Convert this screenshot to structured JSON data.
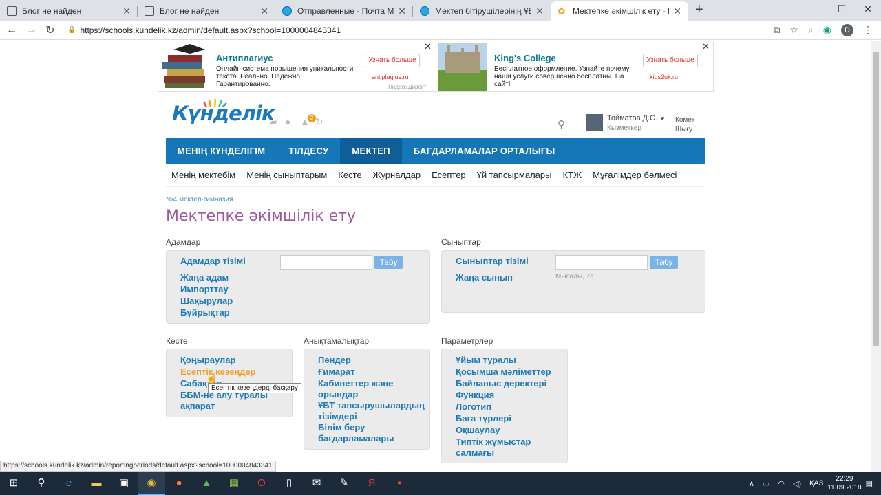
{
  "browser": {
    "tabs": [
      {
        "title": "Блог не найден",
        "active": false
      },
      {
        "title": "Блог не найден",
        "active": false
      },
      {
        "title": "Отправленные - Почта Mail.Ru",
        "active": false
      },
      {
        "title": "Мектеп бітірушілерінің ҰБТ-ға С",
        "active": false
      },
      {
        "title": "Мектепке әкімшілік ету - Kunde",
        "active": true
      }
    ],
    "url": "https://schools.kundelik.kz/admin/default.aspx?school=1000004843341",
    "profile_initial": "D",
    "status_url": "https://schools.kundelik.kz/admin/reportingperiods/default.aspx?school=1000004843341"
  },
  "ads": [
    {
      "title": "Антиплагиус",
      "desc": "Онлайн система повышения уникальности текста. Реально. Надежно. Гарантированно.",
      "button": "Узнать больше",
      "domain": "antiplagius.ru"
    },
    {
      "title": "King's College",
      "desc": "Бесплатное оформление. Узнайте почему наши услуги совершенно бесплатны. На сайт!",
      "button": "Узнать больше",
      "domain": "kids2uk.ru"
    }
  ],
  "ads_source": "Яндекс.Директ",
  "header": {
    "logo": "Күнделік",
    "badge": "2",
    "user_name": "Тойматов Д.С.",
    "user_role": "Қызметкер",
    "help1": "Көмек",
    "help2": "Шығу"
  },
  "mainnav": [
    "МЕНІҢ КҮНДЕЛІГІМ",
    "ТІЛДЕСУ",
    "МЕКТЕП",
    "БАҒДАРЛАМАЛАР ОРТАЛЫҒЫ"
  ],
  "subnav": [
    "Менің мектебім",
    "Менің сыныптарым",
    "Кесте",
    "Журналдар",
    "Есептер",
    "Үй тапсырмалары",
    "КТЖ",
    "Мұғалімдер бөлмесі"
  ],
  "crumb": "№4 мектеп-гимназия",
  "page_title": "Мектепке әкімшілік ету",
  "people": {
    "heading": "Адамдар",
    "links": [
      "Адамдар тізімі",
      "Жаңа адам",
      "Импорттау",
      "Шақырулар",
      "Бұйрықтар"
    ],
    "button": "Табу"
  },
  "classes": {
    "heading": "Сыныптар",
    "links": [
      "Сыныптар тізімі",
      "Жаңа сынып"
    ],
    "button": "Табу",
    "hint": "Мысалы, 7а"
  },
  "schedule": {
    "heading": "Кесте",
    "links": [
      "Қоңыраулар",
      "Есептік кезеңдер",
      "Сабақтар",
      "ББМ-не алу туралы ақпарат"
    ]
  },
  "reference": {
    "heading": "Анықтамалықтар",
    "links": [
      "Пәндер",
      "Ғимарат",
      "Кабинеттер және орындар",
      "ҰБТ тапсырушылардың тізімдері",
      "Білім беру бағдарламалары"
    ]
  },
  "params": {
    "heading": "Параметрлер",
    "links": [
      "Ұйым туралы",
      "Қосымша мәліметтер",
      "Байланыс деректері",
      "Функция",
      "Логотип",
      "Баға түрлері",
      "Оқшаулау",
      "Типтік жұмыстар салмағы"
    ]
  },
  "tooltip": "Есептік кезеңдерді басқару",
  "taskbar": {
    "lang": "ҚАЗ",
    "time": "22:29",
    "date": "11.09.2018"
  }
}
